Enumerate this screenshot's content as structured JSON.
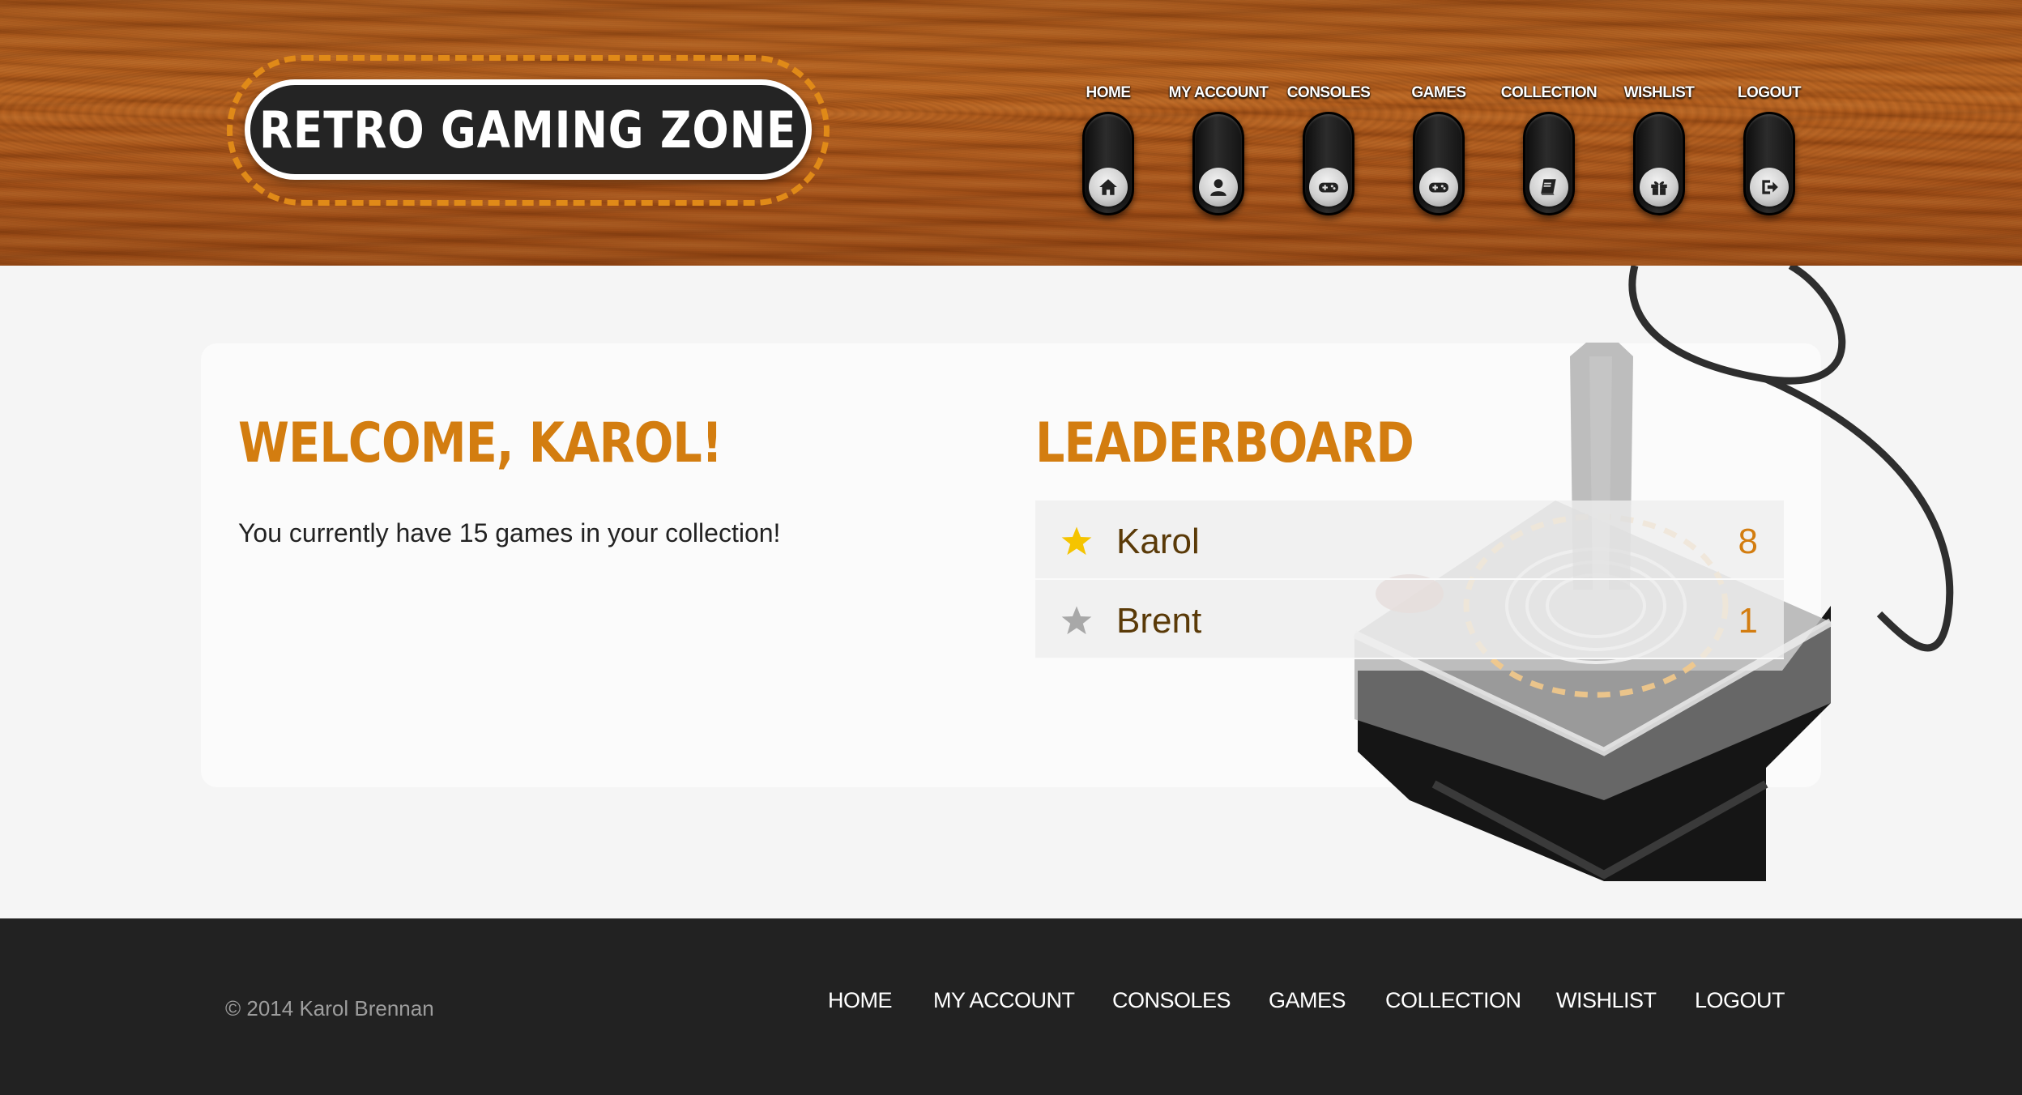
{
  "site": {
    "logo_text": "RETRO GAMING ZONE"
  },
  "nav": {
    "items": [
      {
        "label": "HOME",
        "icon": "home-icon"
      },
      {
        "label": "MY ACCOUNT",
        "icon": "user-icon"
      },
      {
        "label": "CONSOLES",
        "icon": "gamepad-icon"
      },
      {
        "label": "GAMES",
        "icon": "gamepad-icon"
      },
      {
        "label": "COLLECTION",
        "icon": "book-icon"
      },
      {
        "label": "WISHLIST",
        "icon": "gift-icon"
      },
      {
        "label": "LOGOUT",
        "icon": "logout-icon"
      }
    ]
  },
  "welcome": {
    "title": "WELCOME, KAROL!",
    "text": "You currently have 15 games in your collection!"
  },
  "leaderboard": {
    "title": "LEADERBOARD",
    "rows": [
      {
        "name": "Karol",
        "score": "8",
        "star": "gold-star-icon"
      },
      {
        "name": "Brent",
        "score": "1",
        "star": "grey-star-icon"
      }
    ]
  },
  "footer": {
    "copyright": "© 2014 Karol Brennan",
    "links": [
      "HOME",
      "MY ACCOUNT",
      "CONSOLES",
      "GAMES",
      "COLLECTION",
      "WISHLIST",
      "LOGOUT"
    ]
  },
  "colors": {
    "accent": "#d37d10",
    "footer_bg": "#222222",
    "wood": "#b05a1c",
    "star_gold": "#f5c400",
    "star_grey": "#a8a8a8"
  }
}
